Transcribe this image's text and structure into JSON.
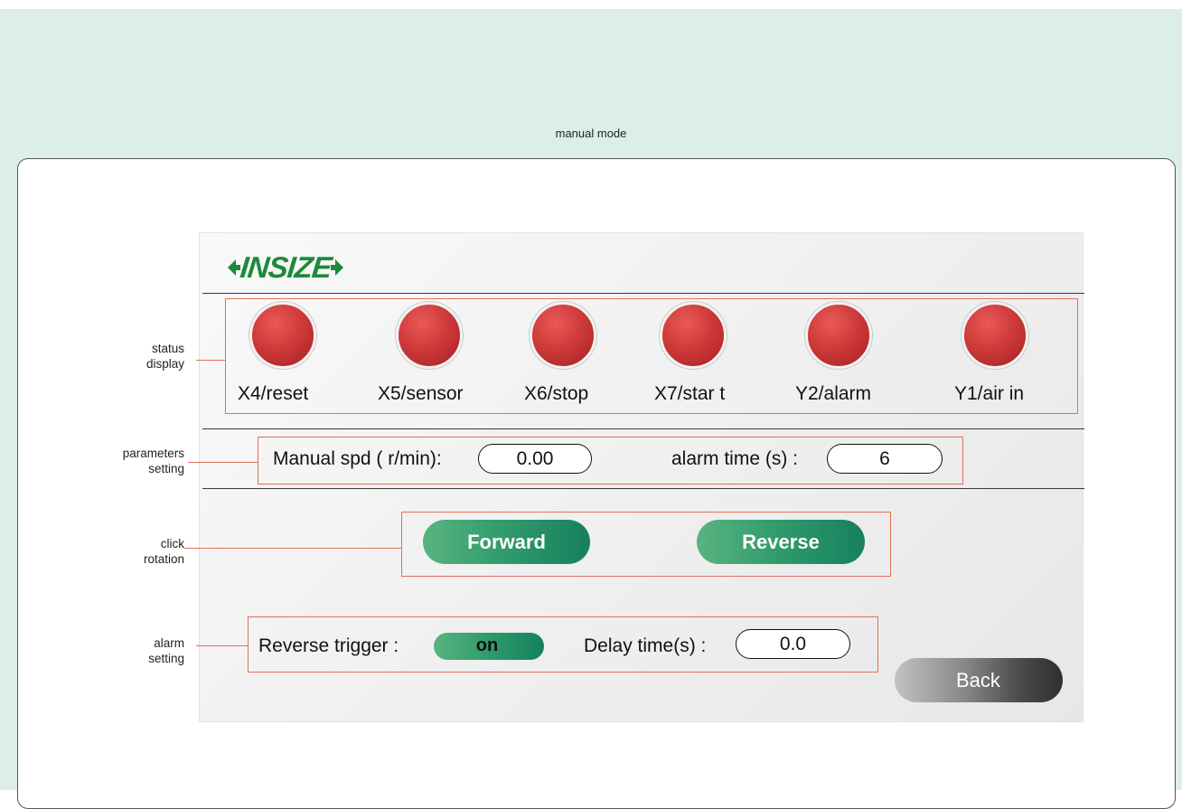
{
  "header": {
    "title": "manual mode"
  },
  "brand": {
    "logo_text": "INSIZE",
    "logo_color": "#1c8a3c"
  },
  "side_labels": {
    "status": [
      "status",
      "display"
    ],
    "parameters": [
      "parameters",
      "setting"
    ],
    "click": [
      "click",
      "rotation"
    ],
    "alarm": [
      "alarm",
      "setting"
    ]
  },
  "status_display": {
    "lamp_color": "#cf3a3a",
    "items": [
      {
        "label": "X4/reset"
      },
      {
        "label": "X5/sensor"
      },
      {
        "label": "X6/stop"
      },
      {
        "label": "X7/star t"
      },
      {
        "label": "Y2/alarm"
      },
      {
        "label": "Y1/air in"
      }
    ]
  },
  "parameters": {
    "manual_speed_label": "Manual spd ( r/min):",
    "manual_speed_value": "0.00",
    "alarm_time_label": "alarm time (s) :",
    "alarm_time_value": "6"
  },
  "rotation": {
    "forward_label": "Forward",
    "reverse_label": "Reverse",
    "button_color": "#2f9a6b"
  },
  "alarm": {
    "reverse_trigger_label": "Reverse trigger  :",
    "reverse_trigger_state": "on",
    "delay_label": "Delay time(s) :",
    "delay_value": "0.0"
  },
  "footer": {
    "back_label": "Back"
  },
  "colors": {
    "accent_box": "#e0705a",
    "background": "#dcefe6"
  }
}
